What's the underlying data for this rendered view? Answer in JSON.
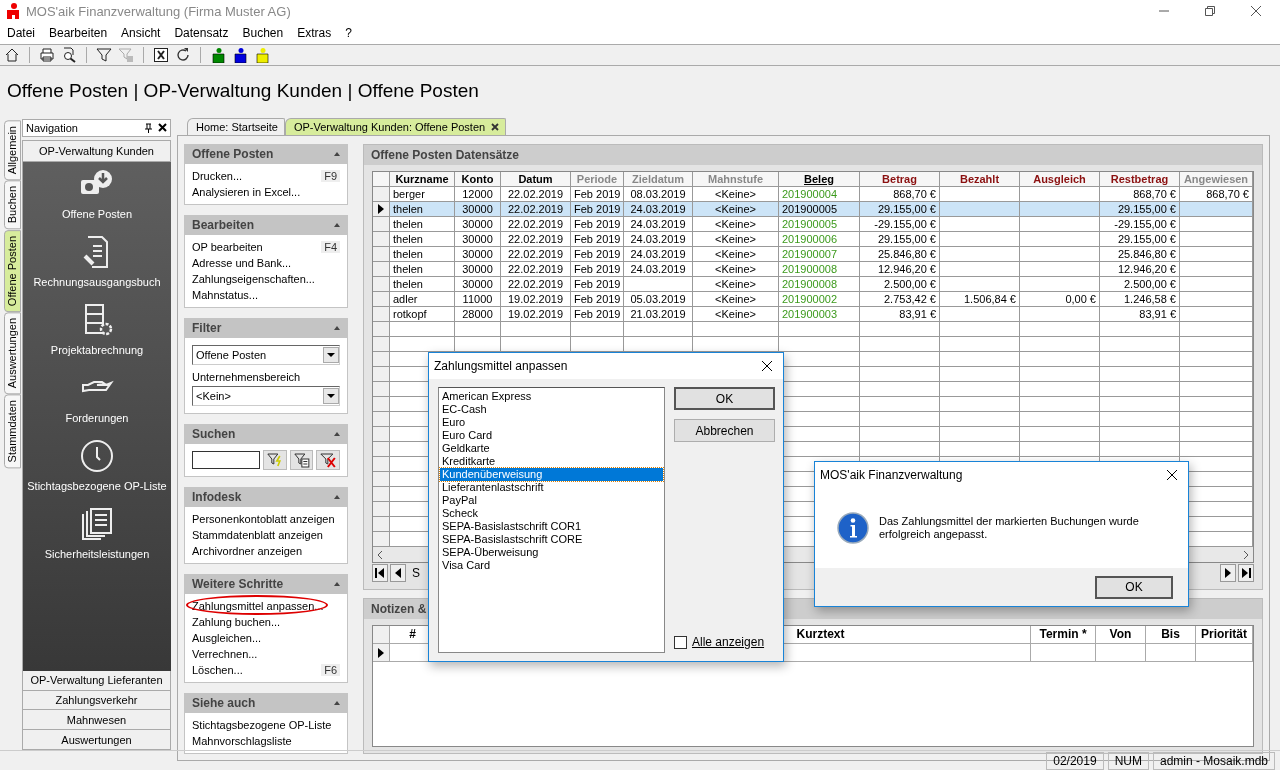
{
  "window": {
    "title": "MOS'aik Finanzverwaltung (Firma Muster AG)"
  },
  "menu": [
    "Datei",
    "Bearbeiten",
    "Ansicht",
    "Datensatz",
    "Buchen",
    "Extras",
    "?"
  ],
  "page_title": "Offene Posten | OP-Verwaltung Kunden | Offene Posten",
  "side_tabs": [
    {
      "label": "Allgemein",
      "selected": false
    },
    {
      "label": "Buchen",
      "selected": false
    },
    {
      "label": "Offene Posten",
      "selected": true
    },
    {
      "label": "Auswertungen",
      "selected": false
    },
    {
      "label": "Stammdaten",
      "selected": false
    }
  ],
  "navigation": {
    "title": "Navigation",
    "section": "OP-Verwaltung Kunden",
    "items": [
      "Offene Posten",
      "Rechnungsausgangsbuch",
      "Projektabrechnung",
      "Forderungen",
      "Stichtagsbezogene OP-Liste",
      "Sicherheitsleistungen"
    ],
    "groups": [
      "OP-Verwaltung Lieferanten",
      "Zahlungsverkehr",
      "Mahnwesen",
      "Auswertungen"
    ]
  },
  "doc_tabs": [
    {
      "label": "Home: Startseite",
      "selected": false,
      "closable": false
    },
    {
      "label": "OP-Verwaltung Kunden: Offene Posten",
      "selected": true,
      "closable": true
    }
  ],
  "task_pane": [
    {
      "title": "Offene Posten",
      "kind": "links",
      "items": [
        {
          "label": "Drucken...",
          "shortcut": "F9"
        },
        {
          "label": "Analysieren in Excel..."
        }
      ]
    },
    {
      "title": "Bearbeiten",
      "kind": "links",
      "items": [
        {
          "label": "OP bearbeiten",
          "shortcut": "F4"
        },
        {
          "label": "Adresse und Bank..."
        },
        {
          "label": "Zahlungseigenschaften..."
        },
        {
          "label": "Mahnstatus..."
        }
      ]
    },
    {
      "title": "Filter",
      "kind": "filter",
      "fields": [
        {
          "kind": "select",
          "value": "Offene Posten"
        },
        {
          "kind": "label",
          "text": "Unternehmensbereich"
        },
        {
          "kind": "select",
          "value": "<Kein>"
        }
      ]
    },
    {
      "title": "Suchen",
      "kind": "search"
    },
    {
      "title": "Infodesk",
      "kind": "links",
      "items": [
        {
          "label": "Personenkontoblatt anzeigen"
        },
        {
          "label": "Stammdatenblatt anzeigen"
        },
        {
          "label": "Archivordner anzeigen"
        }
      ]
    },
    {
      "title": "Weitere Schritte",
      "kind": "links",
      "items": [
        {
          "label": "Zahlungsmittel anpassen...",
          "highlighted": true
        },
        {
          "label": "Zahlung buchen..."
        },
        {
          "label": "Ausgleichen..."
        },
        {
          "label": "Verrechnen..."
        },
        {
          "label": "Löschen...",
          "shortcut": "F6"
        }
      ]
    },
    {
      "title": "Siehe auch",
      "kind": "links",
      "items": [
        {
          "label": "Stichtagsbezogene OP-Liste"
        },
        {
          "label": "Mahnvorschlagsliste"
        }
      ]
    }
  ],
  "grid": {
    "title": "Offene Posten Datensätze",
    "columns": [
      {
        "label": "Kurzname",
        "kind": "key"
      },
      {
        "label": "Konto",
        "kind": "key"
      },
      {
        "label": "Datum",
        "kind": "key"
      },
      {
        "label": "Periode",
        "kind": "muted"
      },
      {
        "label": "Zieldatum",
        "kind": "muted"
      },
      {
        "label": "Mahnstufe",
        "kind": "muted"
      },
      {
        "label": "Beleg",
        "kind": "sorted",
        "link": true
      },
      {
        "label": "Betrag",
        "kind": "amount"
      },
      {
        "label": "Bezahlt",
        "kind": "amount"
      },
      {
        "label": "Ausgleich",
        "kind": "amount"
      },
      {
        "label": "Restbetrag",
        "kind": "amount"
      },
      {
        "label": "Angewiesen",
        "kind": "muted"
      }
    ],
    "rows": [
      {
        "selected": false,
        "cells": [
          "berger",
          "12000",
          "22.02.2019",
          "Feb 2019",
          "08.03.2019",
          "<Keine>",
          "201900004",
          "868,70 €",
          null,
          null,
          "868,70 €",
          "868,70 €"
        ]
      },
      {
        "selected": true,
        "cells": [
          "thelen",
          "30000",
          "22.02.2019",
          "Feb 2019",
          "24.03.2019",
          "<Keine>",
          "201900005",
          "29.155,00 €",
          null,
          null,
          "29.155,00 €",
          null
        ]
      },
      {
        "selected": false,
        "cells": [
          "thelen",
          "30000",
          "22.02.2019",
          "Feb 2019",
          "24.03.2019",
          "<Keine>",
          "201900005",
          "-29.155,00 €",
          null,
          null,
          "-29.155,00 €",
          null
        ]
      },
      {
        "selected": false,
        "cells": [
          "thelen",
          "30000",
          "22.02.2019",
          "Feb 2019",
          "24.03.2019",
          "<Keine>",
          "201900006",
          "29.155,00 €",
          null,
          null,
          "29.155,00 €",
          null
        ]
      },
      {
        "selected": false,
        "cells": [
          "thelen",
          "30000",
          "22.02.2019",
          "Feb 2019",
          "24.03.2019",
          "<Keine>",
          "201900007",
          "25.846,80 €",
          null,
          null,
          "25.846,80 €",
          null
        ]
      },
      {
        "selected": false,
        "cells": [
          "thelen",
          "30000",
          "22.02.2019",
          "Feb 2019",
          "24.03.2019",
          "<Keine>",
          "201900008",
          "12.946,20 €",
          null,
          null,
          "12.946,20 €",
          null
        ]
      },
      {
        "selected": false,
        "cells": [
          "thelen",
          "30000",
          "22.02.2019",
          "Feb 2019",
          null,
          "<Keine>",
          "201900008",
          "2.500,00 €",
          null,
          null,
          "2.500,00 €",
          null
        ]
      },
      {
        "selected": false,
        "cells": [
          "adler",
          "11000",
          "19.02.2019",
          "Feb 2019",
          "05.03.2019",
          "<Keine>",
          "201900002",
          "2.753,42 €",
          "1.506,84 €",
          "0,00 €",
          "1.246,58 €",
          null
        ]
      },
      {
        "selected": false,
        "cells": [
          "rotkopf",
          "28000",
          "19.02.2019",
          "Feb 2019",
          "21.03.2019",
          "<Keine>",
          "201900003",
          "83,91 €",
          null,
          null,
          "83,91 €",
          null
        ]
      }
    ],
    "record_label": "S"
  },
  "notes": {
    "title": "Notizen &",
    "columns": [
      "#",
      "Kurztext",
      "Termin *",
      "Von",
      "Bis",
      "Priorität"
    ]
  },
  "payment_dialog": {
    "title": "Zahlungsmittel anpassen",
    "items": [
      {
        "label": "American Express",
        "selected": false
      },
      {
        "label": "EC-Cash",
        "selected": false
      },
      {
        "label": "Euro",
        "selected": false
      },
      {
        "label": "Euro Card",
        "selected": false
      },
      {
        "label": "Geldkarte",
        "selected": false
      },
      {
        "label": "Kreditkarte",
        "selected": false
      },
      {
        "label": "Kundenüberweisung",
        "selected": true
      },
      {
        "label": "Lieferantenlastschrift",
        "selected": false
      },
      {
        "label": "PayPal",
        "selected": false
      },
      {
        "label": "Scheck",
        "selected": false
      },
      {
        "label": "SEPA-Basislastschrift COR1",
        "selected": false
      },
      {
        "label": "SEPA-Basislastschrift CORE",
        "selected": false
      },
      {
        "label": "SEPA-Überweisung",
        "selected": false
      },
      {
        "label": "Visa Card",
        "selected": false
      }
    ],
    "buttons": [
      {
        "label": "OK",
        "default": true
      },
      {
        "label": "Abbrechen",
        "default": false
      }
    ],
    "checkbox": {
      "label": "Alle anzeigen",
      "checked": false
    }
  },
  "message_box": {
    "title": "MOS'aik Finanzverwaltung",
    "message": "Das Zahlungsmittel der markierten Buchungen wurde erfolgreich angepasst.",
    "button": "OK"
  },
  "status_bar": [
    "02/2019",
    "NUM",
    "admin - Mosaik.mdb"
  ]
}
